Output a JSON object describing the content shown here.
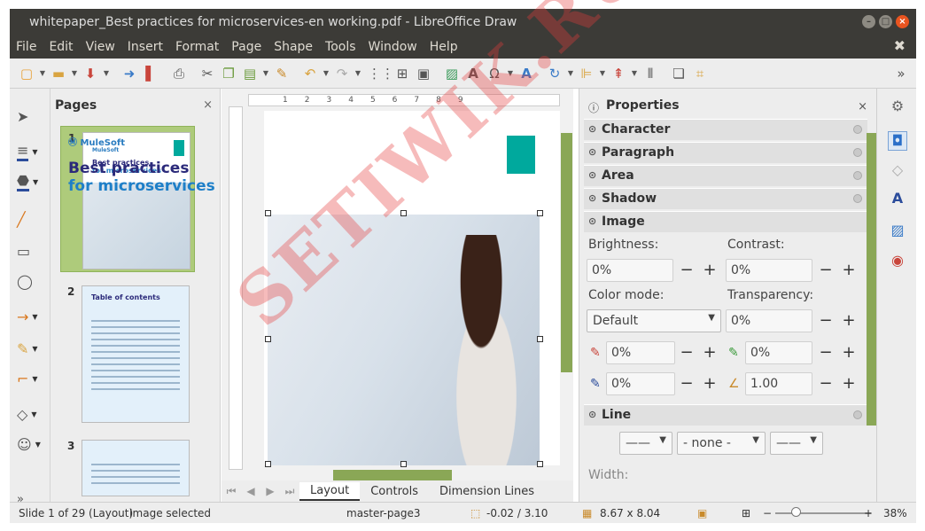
{
  "window": {
    "title": "whitepaper_Best practices for microservices-en working.pdf - LibreOffice Draw"
  },
  "menu": {
    "items": [
      "File",
      "Edit",
      "View",
      "Insert",
      "Format",
      "Page",
      "Shape",
      "Tools",
      "Window",
      "Help"
    ]
  },
  "pages_panel": {
    "title": "Pages",
    "close": "×",
    "thumbs": [
      {
        "num": "1",
        "logo": "MuleSoft",
        "title_a": "Best practices",
        "title_b": "for microservices"
      },
      {
        "num": "2",
        "title_a": "Table of contents"
      },
      {
        "num": "3"
      }
    ]
  },
  "document": {
    "logo": "MuleSoft",
    "title_a": "Best practices",
    "title_b": "for microservices"
  },
  "ruler": {
    "ticks": [
      "1",
      "1",
      "2",
      "3",
      "4",
      "5",
      "6",
      "7",
      "8",
      "9"
    ]
  },
  "tabs": {
    "items": [
      "Layout",
      "Controls",
      "Dimension Lines"
    ],
    "active": "Layout"
  },
  "properties": {
    "title": "Properties",
    "close": "×",
    "sections": [
      "Character",
      "Paragraph",
      "Area",
      "Shadow",
      "Image",
      "Line"
    ],
    "image": {
      "brightness_label": "Brightness:",
      "brightness": "0%",
      "contrast_label": "Contrast:",
      "contrast": "0%",
      "color_mode_label": "Color mode:",
      "color_mode": "Default",
      "transparency_label": "Transparency:",
      "transparency": "0%",
      "red": "0%",
      "green": "0%",
      "blue": "0%",
      "gamma": "1.00"
    },
    "line": {
      "style": "——",
      "arrow": "- none -",
      "end": "——",
      "width_label": "Width:"
    }
  },
  "status": {
    "slide": "Slide 1 of 29 (Layout)",
    "selection": "Image selected",
    "master": "master-page3",
    "position": "-0.02 / 3.10",
    "size": "8.67 x 8.04",
    "zoom": "38%"
  },
  "watermark": "SETIWIK.RU"
}
